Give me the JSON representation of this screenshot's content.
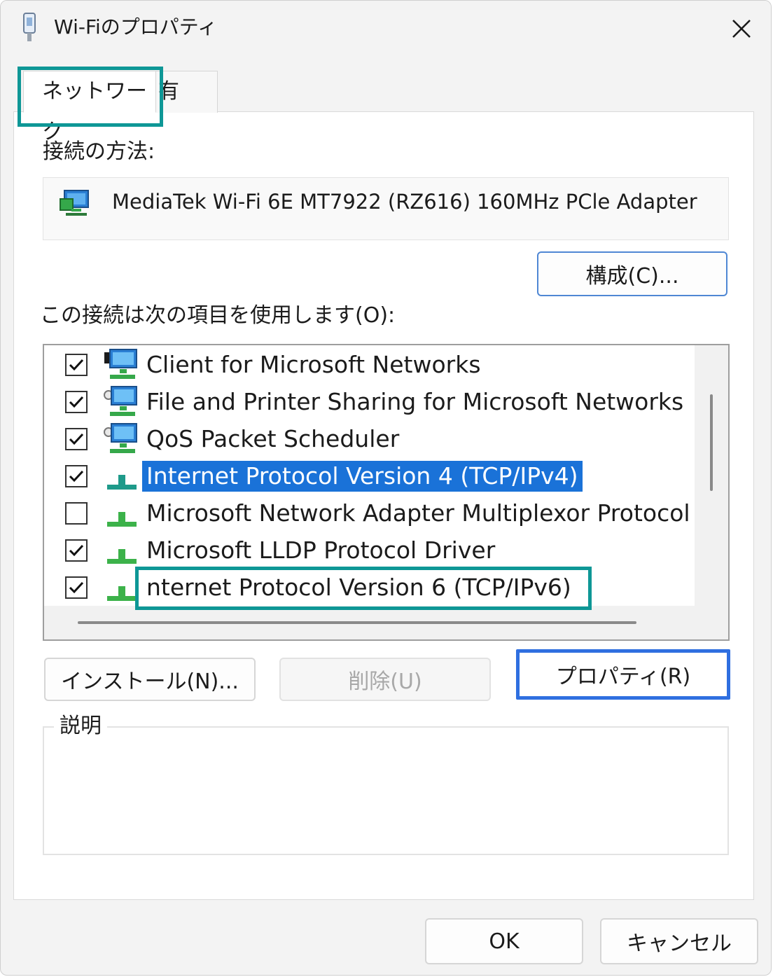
{
  "window": {
    "title": "Wi-Fiのプロパティ"
  },
  "tabs": [
    {
      "label": "ネットワーク",
      "selected": true
    },
    {
      "label": "共有",
      "visible_text": "有",
      "selected": false
    }
  ],
  "connect_using": {
    "label": "接続の方法:",
    "adapter": "MediaTek Wi-Fi 6E MT7922 (RZ616) 160MHz PCle Adapter",
    "configure_label": "構成(C)..."
  },
  "items_section": {
    "label": "この接続は次の項目を使用します(O):",
    "items": [
      {
        "label": "Client for Microsoft Networks",
        "checked": true,
        "icon": "client-network-icon",
        "selected": false
      },
      {
        "label": "File and Printer Sharing for Microsoft Networks",
        "checked": true,
        "icon": "service-network-icon",
        "selected": false
      },
      {
        "label": "QoS Packet Scheduler",
        "checked": true,
        "icon": "service-network-icon",
        "selected": false
      },
      {
        "label": "Internet Protocol Version 4 (TCP/IPv4)",
        "checked": true,
        "icon": "protocol-icon",
        "selected": true
      },
      {
        "label": "Microsoft Network Adapter Multiplexor Protocol",
        "checked": false,
        "icon": "protocol-icon",
        "selected": false
      },
      {
        "label": "Microsoft LLDP Protocol Driver",
        "checked": true,
        "icon": "protocol-icon",
        "selected": false
      },
      {
        "label": "nternet Protocol Version 6 (TCP/IPv6)",
        "checked": true,
        "icon": "protocol-icon",
        "selected": false
      }
    ]
  },
  "buttons": {
    "install": "インストール(N)...",
    "remove": "削除(U)",
    "properties": "プロパティ(R)",
    "ok": "OK",
    "cancel": "キャンセル"
  },
  "description": {
    "legend": "説明",
    "text": ""
  },
  "colors": {
    "highlight_teal": "#0e9796",
    "highlight_blue": "#2f6fe0",
    "selection": "#1a72d8"
  }
}
